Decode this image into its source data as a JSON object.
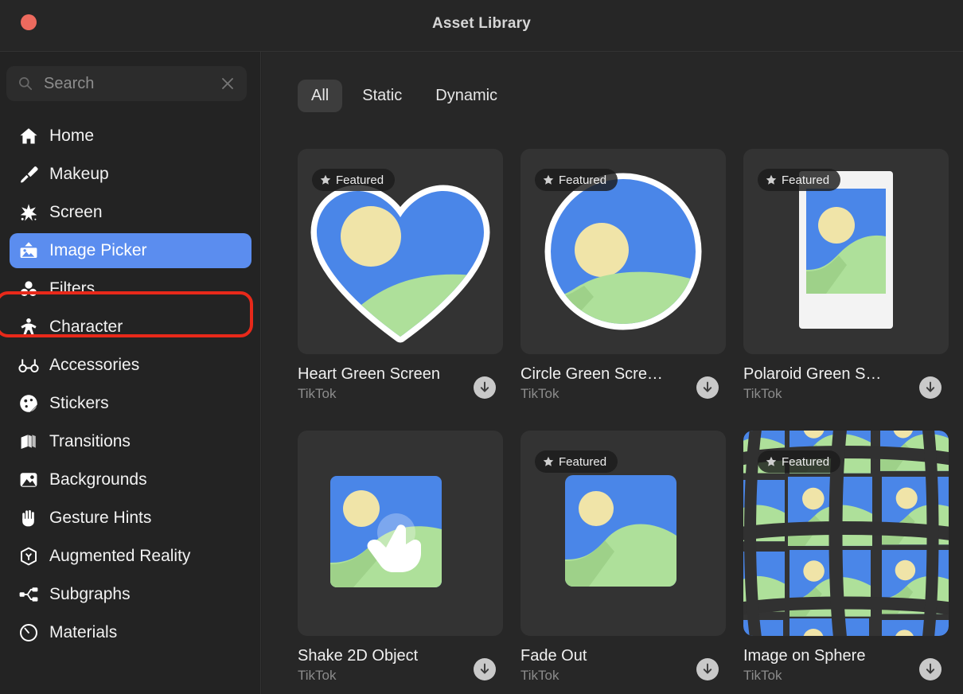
{
  "window": {
    "title": "Asset Library",
    "close_button": "close-window"
  },
  "sidebar": {
    "search": {
      "placeholder": "Search",
      "value": "",
      "search_icon": "search-icon",
      "clear_icon": "close-icon"
    },
    "items": [
      {
        "label": "Home",
        "icon": "home-icon",
        "selected": false
      },
      {
        "label": "Makeup",
        "icon": "brush-icon",
        "selected": false
      },
      {
        "label": "Screen",
        "icon": "sparkle-icon",
        "selected": false
      },
      {
        "label": "Image Picker",
        "icon": "image-upload-icon",
        "selected": true
      },
      {
        "label": "Filters",
        "icon": "filters-icon",
        "selected": false
      },
      {
        "label": "Character",
        "icon": "person-icon",
        "selected": false
      },
      {
        "label": "Accessories",
        "icon": "glasses-icon",
        "selected": false
      },
      {
        "label": "Stickers",
        "icon": "sticker-icon",
        "selected": false
      },
      {
        "label": "Transitions",
        "icon": "layers-icon",
        "selected": false
      },
      {
        "label": "Backgrounds",
        "icon": "picture-icon",
        "selected": false
      },
      {
        "label": "Gesture Hints",
        "icon": "hand-icon",
        "selected": false
      },
      {
        "label": "Augmented Reality",
        "icon": "ar-cube-icon",
        "selected": false
      },
      {
        "label": "Subgraphs",
        "icon": "subgraph-icon",
        "selected": false
      },
      {
        "label": "Materials",
        "icon": "material-icon",
        "selected": false
      }
    ],
    "highlight_color": "#5b8def",
    "annotation_ring_color": "#e8291a"
  },
  "main": {
    "tabs": [
      {
        "label": "All",
        "active": true
      },
      {
        "label": "Static",
        "active": false
      },
      {
        "label": "Dynamic",
        "active": false
      }
    ],
    "badge_label": "Featured",
    "assets": [
      {
        "title": "Heart Green Screen",
        "source": "TikTok",
        "featured": true,
        "art": "heart",
        "download_icon": "download-icon"
      },
      {
        "title": "Circle Green Scre…",
        "source": "TikTok",
        "featured": true,
        "art": "circle",
        "download_icon": "download-icon"
      },
      {
        "title": "Polaroid Green S…",
        "source": "TikTok",
        "featured": true,
        "art": "polaroid",
        "download_icon": "download-icon"
      },
      {
        "title": "Shake 2D Object",
        "source": "TikTok",
        "featured": false,
        "art": "shake",
        "download_icon": "download-icon"
      },
      {
        "title": "Fade Out",
        "source": "TikTok",
        "featured": true,
        "art": "fade",
        "download_icon": "download-icon"
      },
      {
        "title": "Image on Sphere",
        "source": "TikTok",
        "featured": true,
        "art": "sphere",
        "download_icon": "download-icon"
      }
    ]
  },
  "colors": {
    "window_bg": "#232323",
    "content_bg": "#272727",
    "thumb_bg": "#333333",
    "accent_blue": "#5b8def",
    "art_sky": "#4a86e8",
    "art_ground": "#aee09a",
    "art_sun": "#f0e4a8",
    "close_red": "#ed6a5e"
  }
}
